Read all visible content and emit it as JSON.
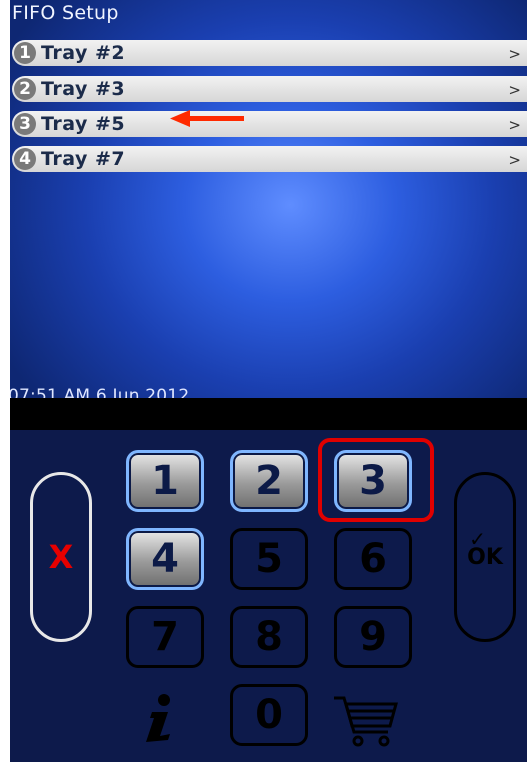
{
  "screen": {
    "title": "FIFO Setup",
    "trays": [
      {
        "num": "1",
        "label": "Tray #2",
        "chevron": ">"
      },
      {
        "num": "2",
        "label": "Tray #3",
        "chevron": ">"
      },
      {
        "num": "3",
        "label": "Tray #5",
        "chevron": ">"
      },
      {
        "num": "4",
        "label": "Tray #7",
        "chevron": ">"
      }
    ],
    "datetime": "07:51 AM 6 Jun 2012"
  },
  "keypad": {
    "keys": [
      "1",
      "2",
      "3",
      "4",
      "5",
      "6",
      "7",
      "8",
      "9",
      "0"
    ],
    "enabled_keys": [
      "1",
      "2",
      "3",
      "4"
    ],
    "cancel_label": "X",
    "ok_label": "OK",
    "info_icon": "info-icon",
    "cart_icon": "cart-icon"
  },
  "annotations": {
    "arrow_color": "#ff2a00",
    "highlight_color": "#e00000"
  }
}
